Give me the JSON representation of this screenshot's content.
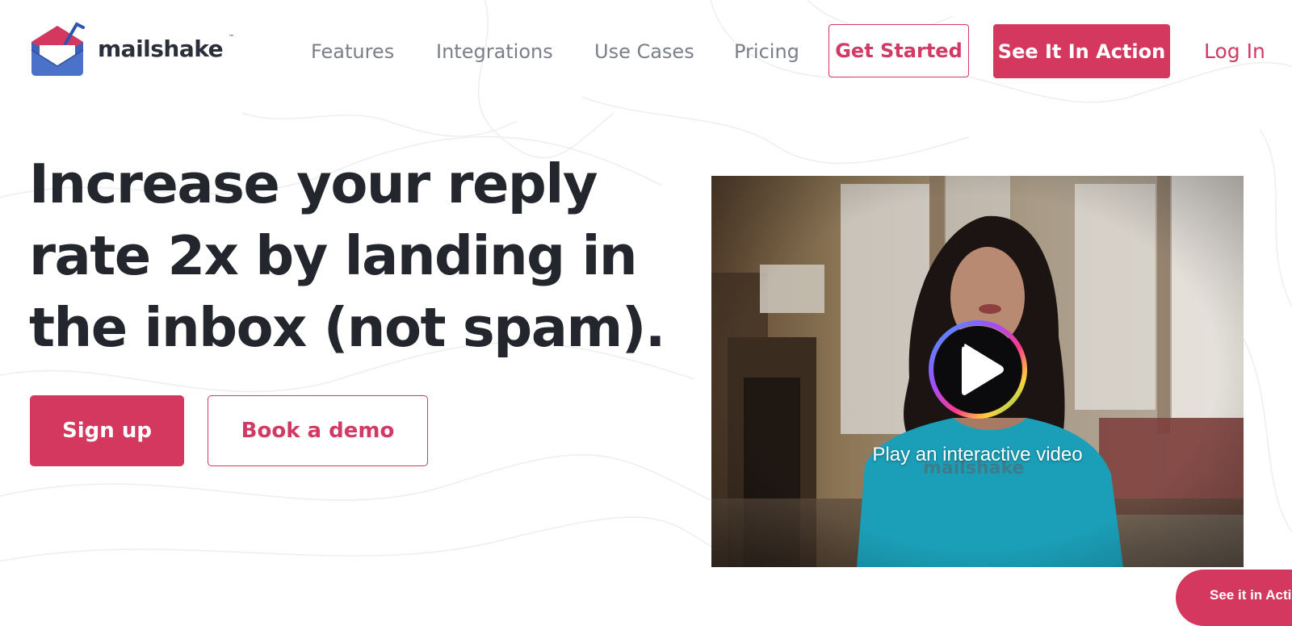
{
  "brand": {
    "name": "mailshake",
    "trademark": "™",
    "accent": "#d4385f"
  },
  "nav": {
    "links": [
      "Features",
      "Integrations",
      "Use Cases",
      "Pricing"
    ],
    "get_started": "Get Started",
    "see_it_in_action": "See It In Action",
    "log_in": "Log In"
  },
  "hero": {
    "headline_lines": [
      "Increase your reply",
      "rate 2x by landing in",
      "the inbox (not spam)."
    ],
    "signup": "Sign up",
    "book_demo": "Book a demo"
  },
  "video": {
    "caption": "Play an interactive video",
    "shirt_text": "mailshake",
    "play_icon": "play-icon"
  },
  "floating": {
    "label": "See it in Action"
  }
}
